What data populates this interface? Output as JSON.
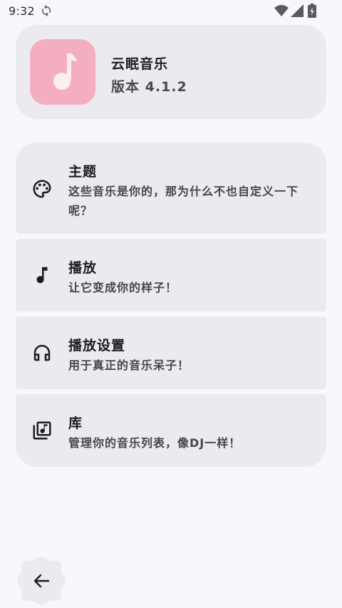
{
  "status_bar": {
    "time": "9:32",
    "icons": [
      "sync-icon",
      "wifi-icon",
      "signal-icon",
      "battery-charging-icon"
    ]
  },
  "app_info": {
    "name": "云眠音乐",
    "version": "版本 4.1.2",
    "icon": "music-note-icon",
    "icon_bg_color": "#f4aec1"
  },
  "menu": {
    "items": [
      {
        "title": "主题",
        "subtitle": "这些音乐是你的，那为什么不也自定义一下呢？",
        "icon": "palette-icon"
      },
      {
        "title": "播放",
        "subtitle": "让它变成你的样子！",
        "icon": "music-note-icon"
      },
      {
        "title": "播放设置",
        "subtitle": "用于真正的音乐呆子！",
        "icon": "headphones-icon"
      },
      {
        "title": "库",
        "subtitle": "管理你的音乐列表，像DJ一样！",
        "icon": "library-music-icon"
      }
    ]
  },
  "back_button": {
    "icon": "arrow-back-icon"
  },
  "colors": {
    "background": "#f8f7fb",
    "card": "#ebeaee",
    "accent_pink": "#f4aec1"
  }
}
